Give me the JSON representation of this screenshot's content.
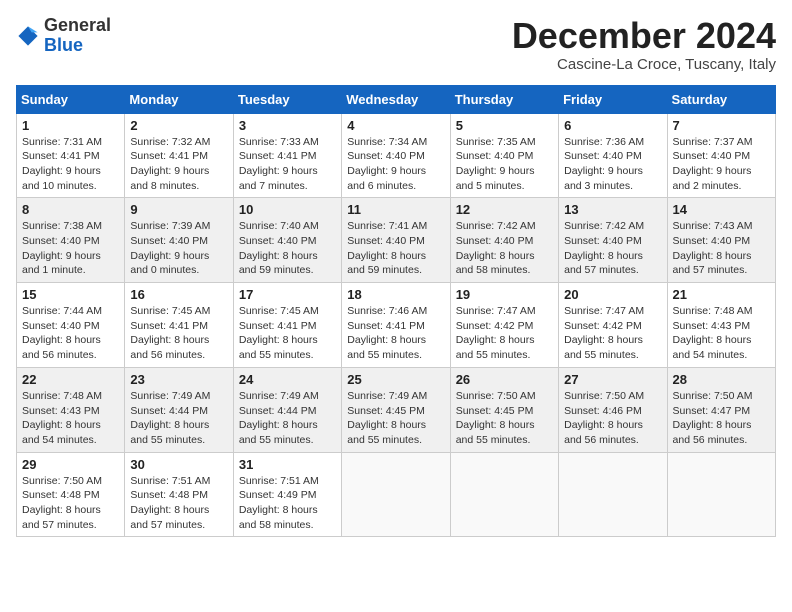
{
  "header": {
    "logo_general": "General",
    "logo_blue": "Blue",
    "month_title": "December 2024",
    "location": "Cascine-La Croce, Tuscany, Italy"
  },
  "days_of_week": [
    "Sunday",
    "Monday",
    "Tuesday",
    "Wednesday",
    "Thursday",
    "Friday",
    "Saturday"
  ],
  "weeks": [
    [
      {
        "day": "1",
        "sunrise": "Sunrise: 7:31 AM",
        "sunset": "Sunset: 4:41 PM",
        "daylight": "Daylight: 9 hours and 10 minutes."
      },
      {
        "day": "2",
        "sunrise": "Sunrise: 7:32 AM",
        "sunset": "Sunset: 4:41 PM",
        "daylight": "Daylight: 9 hours and 8 minutes."
      },
      {
        "day": "3",
        "sunrise": "Sunrise: 7:33 AM",
        "sunset": "Sunset: 4:41 PM",
        "daylight": "Daylight: 9 hours and 7 minutes."
      },
      {
        "day": "4",
        "sunrise": "Sunrise: 7:34 AM",
        "sunset": "Sunset: 4:40 PM",
        "daylight": "Daylight: 9 hours and 6 minutes."
      },
      {
        "day": "5",
        "sunrise": "Sunrise: 7:35 AM",
        "sunset": "Sunset: 4:40 PM",
        "daylight": "Daylight: 9 hours and 5 minutes."
      },
      {
        "day": "6",
        "sunrise": "Sunrise: 7:36 AM",
        "sunset": "Sunset: 4:40 PM",
        "daylight": "Daylight: 9 hours and 3 minutes."
      },
      {
        "day": "7",
        "sunrise": "Sunrise: 7:37 AM",
        "sunset": "Sunset: 4:40 PM",
        "daylight": "Daylight: 9 hours and 2 minutes."
      }
    ],
    [
      {
        "day": "8",
        "sunrise": "Sunrise: 7:38 AM",
        "sunset": "Sunset: 4:40 PM",
        "daylight": "Daylight: 9 hours and 1 minute."
      },
      {
        "day": "9",
        "sunrise": "Sunrise: 7:39 AM",
        "sunset": "Sunset: 4:40 PM",
        "daylight": "Daylight: 9 hours and 0 minutes."
      },
      {
        "day": "10",
        "sunrise": "Sunrise: 7:40 AM",
        "sunset": "Sunset: 4:40 PM",
        "daylight": "Daylight: 8 hours and 59 minutes."
      },
      {
        "day": "11",
        "sunrise": "Sunrise: 7:41 AM",
        "sunset": "Sunset: 4:40 PM",
        "daylight": "Daylight: 8 hours and 59 minutes."
      },
      {
        "day": "12",
        "sunrise": "Sunrise: 7:42 AM",
        "sunset": "Sunset: 4:40 PM",
        "daylight": "Daylight: 8 hours and 58 minutes."
      },
      {
        "day": "13",
        "sunrise": "Sunrise: 7:42 AM",
        "sunset": "Sunset: 4:40 PM",
        "daylight": "Daylight: 8 hours and 57 minutes."
      },
      {
        "day": "14",
        "sunrise": "Sunrise: 7:43 AM",
        "sunset": "Sunset: 4:40 PM",
        "daylight": "Daylight: 8 hours and 57 minutes."
      }
    ],
    [
      {
        "day": "15",
        "sunrise": "Sunrise: 7:44 AM",
        "sunset": "Sunset: 4:40 PM",
        "daylight": "Daylight: 8 hours and 56 minutes."
      },
      {
        "day": "16",
        "sunrise": "Sunrise: 7:45 AM",
        "sunset": "Sunset: 4:41 PM",
        "daylight": "Daylight: 8 hours and 56 minutes."
      },
      {
        "day": "17",
        "sunrise": "Sunrise: 7:45 AM",
        "sunset": "Sunset: 4:41 PM",
        "daylight": "Daylight: 8 hours and 55 minutes."
      },
      {
        "day": "18",
        "sunrise": "Sunrise: 7:46 AM",
        "sunset": "Sunset: 4:41 PM",
        "daylight": "Daylight: 8 hours and 55 minutes."
      },
      {
        "day": "19",
        "sunrise": "Sunrise: 7:47 AM",
        "sunset": "Sunset: 4:42 PM",
        "daylight": "Daylight: 8 hours and 55 minutes."
      },
      {
        "day": "20",
        "sunrise": "Sunrise: 7:47 AM",
        "sunset": "Sunset: 4:42 PM",
        "daylight": "Daylight: 8 hours and 55 minutes."
      },
      {
        "day": "21",
        "sunrise": "Sunrise: 7:48 AM",
        "sunset": "Sunset: 4:43 PM",
        "daylight": "Daylight: 8 hours and 54 minutes."
      }
    ],
    [
      {
        "day": "22",
        "sunrise": "Sunrise: 7:48 AM",
        "sunset": "Sunset: 4:43 PM",
        "daylight": "Daylight: 8 hours and 54 minutes."
      },
      {
        "day": "23",
        "sunrise": "Sunrise: 7:49 AM",
        "sunset": "Sunset: 4:44 PM",
        "daylight": "Daylight: 8 hours and 55 minutes."
      },
      {
        "day": "24",
        "sunrise": "Sunrise: 7:49 AM",
        "sunset": "Sunset: 4:44 PM",
        "daylight": "Daylight: 8 hours and 55 minutes."
      },
      {
        "day": "25",
        "sunrise": "Sunrise: 7:49 AM",
        "sunset": "Sunset: 4:45 PM",
        "daylight": "Daylight: 8 hours and 55 minutes."
      },
      {
        "day": "26",
        "sunrise": "Sunrise: 7:50 AM",
        "sunset": "Sunset: 4:45 PM",
        "daylight": "Daylight: 8 hours and 55 minutes."
      },
      {
        "day": "27",
        "sunrise": "Sunrise: 7:50 AM",
        "sunset": "Sunset: 4:46 PM",
        "daylight": "Daylight: 8 hours and 56 minutes."
      },
      {
        "day": "28",
        "sunrise": "Sunrise: 7:50 AM",
        "sunset": "Sunset: 4:47 PM",
        "daylight": "Daylight: 8 hours and 56 minutes."
      }
    ],
    [
      {
        "day": "29",
        "sunrise": "Sunrise: 7:50 AM",
        "sunset": "Sunset: 4:48 PM",
        "daylight": "Daylight: 8 hours and 57 minutes."
      },
      {
        "day": "30",
        "sunrise": "Sunrise: 7:51 AM",
        "sunset": "Sunset: 4:48 PM",
        "daylight": "Daylight: 8 hours and 57 minutes."
      },
      {
        "day": "31",
        "sunrise": "Sunrise: 7:51 AM",
        "sunset": "Sunset: 4:49 PM",
        "daylight": "Daylight: 8 hours and 58 minutes."
      },
      null,
      null,
      null,
      null
    ]
  ]
}
